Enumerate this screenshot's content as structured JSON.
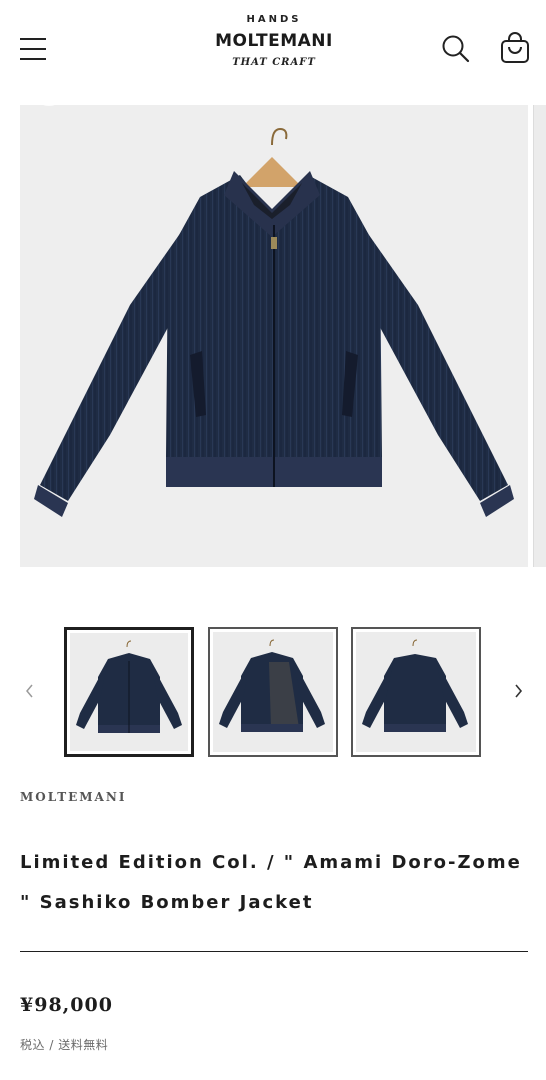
{
  "header": {
    "menu_icon": "hamburger-menu-icon",
    "logo": {
      "top_text": "HANDS",
      "main_text": "MOLTEMANI",
      "bottom_text": "THAT CRAFT"
    },
    "search_icon": "search-icon",
    "cart_icon": "cart-icon"
  },
  "gallery": {
    "main_image": "navy sashiko bomber jacket on wooden hanger",
    "thumbnails": [
      {
        "view": "front",
        "active": true
      },
      {
        "view": "open front lining",
        "active": false
      },
      {
        "view": "back",
        "active": false
      }
    ],
    "prev_icon": "chevron-left-icon",
    "next_icon": "chevron-right-icon"
  },
  "product": {
    "vendor": "MOLTEMANI",
    "title": "Limited Edition Col. / \" Amami Doro-Zome \" Sashiko Bomber Jacket",
    "price": "¥98,000",
    "tax_note": "税込",
    "shipping_note": "送料無料",
    "note_separator": " / "
  },
  "colors": {
    "text": "#1f1f1f",
    "jacket": "#1f2c44",
    "background": "#ffffff",
    "image_bg": "#eeeeee"
  }
}
